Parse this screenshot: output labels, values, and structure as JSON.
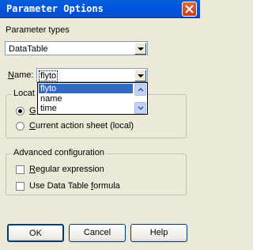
{
  "window": {
    "title": "Parameter Options"
  },
  "param_types": {
    "label": "Parameter types",
    "value": "DataTable"
  },
  "name_field": {
    "label_prefix": "",
    "label_access": "N",
    "label_rest": "ame:",
    "value": "flyto"
  },
  "dropdown": {
    "items": [
      "flyto",
      "name",
      "time"
    ],
    "selected_index": 0
  },
  "location": {
    "label_partial": "Locat",
    "option_global_partial": "G",
    "option_local_prefix": "",
    "option_local_access": "C",
    "option_local_rest": "urrent action sheet (local)"
  },
  "advanced": {
    "label": "Advanced configuration",
    "regex_access": "R",
    "regex_rest": "egular expression",
    "formula_prefix": "Use Data Table ",
    "formula_access": "f",
    "formula_rest": "ormula"
  },
  "buttons": {
    "ok": "OK",
    "cancel": "Cancel",
    "help": "Help"
  }
}
